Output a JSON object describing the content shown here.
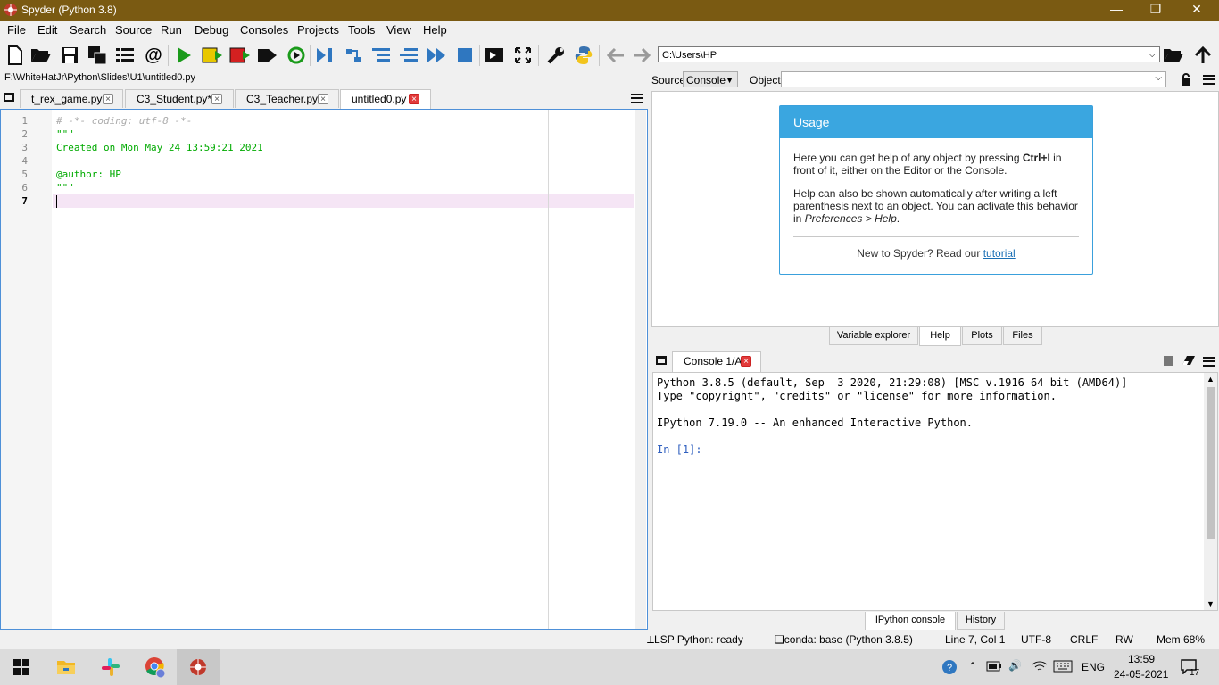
{
  "window": {
    "title": "Spyder (Python 3.8)",
    "minimize": "—",
    "restore": "❐",
    "close": "✕"
  },
  "menu": [
    "File",
    "Edit",
    "Search",
    "Source",
    "Run",
    "Debug",
    "Consoles",
    "Projects",
    "Tools",
    "View",
    "Help"
  ],
  "toolbar": {
    "path": "C:\\Users\\HP"
  },
  "editor": {
    "file_path": "F:\\WhiteHatJr\\Python\\Slides\\U1\\untitled0.py",
    "tabs": [
      "t_rex_game.py",
      "C3_Student.py*",
      "C3_Teacher.py",
      "untitled0.py"
    ],
    "line_numbers": [
      "1",
      "2",
      "3",
      "4",
      "5",
      "6",
      "7"
    ],
    "lines": [
      "# -*- coding: utf-8 -*-",
      "\"\"\"",
      "Created on Mon May 24 13:59:21 2021",
      "",
      "@author: HP",
      "\"\"\"",
      ""
    ]
  },
  "help": {
    "source_label": "Source",
    "source_value": "Console",
    "object_label": "Object",
    "usage_title": "Usage",
    "p1_a": "Here you can get help of any object by pressing ",
    "p1_b": "Ctrl+I",
    "p1_c": " in front of it, either on the Editor or the Console.",
    "p2_a": "Help can also be shown automatically after writing a left parenthesis next to an object. You can activate this behavior in ",
    "p2_b": "Preferences > Help",
    "p2_c": ".",
    "foot_a": "New to Spyder? Read our ",
    "foot_link": "tutorial",
    "tabs": [
      "Variable explorer",
      "Help",
      "Plots",
      "Files"
    ]
  },
  "console": {
    "tab": "Console 1/A",
    "lines": [
      "Python 3.8.5 (default, Sep  3 2020, 21:29:08) [MSC v.1916 64 bit (AMD64)]",
      "Type \"copyright\", \"credits\" or \"license\" for more information.",
      "",
      "IPython 7.19.0 -- An enhanced Interactive Python.",
      "",
      "In [1]:"
    ],
    "tabs": [
      "IPython console",
      "History"
    ]
  },
  "status": {
    "lsp": "LSP Python: ready",
    "conda": "conda: base (Python 3.8.5)",
    "position": "Line 7, Col 1",
    "encoding": "UTF-8",
    "eol": "CRLF",
    "rw": "RW",
    "mem": "Mem 68%"
  },
  "taskbar": {
    "lang": "ENG",
    "time": "13:59",
    "date": "24-05-2021",
    "notif": "17"
  },
  "colors": {
    "titlebar": "#7a5a12",
    "accent": "#3aa6e0",
    "comment": "#aaaaaa",
    "string": "#00aa00"
  }
}
